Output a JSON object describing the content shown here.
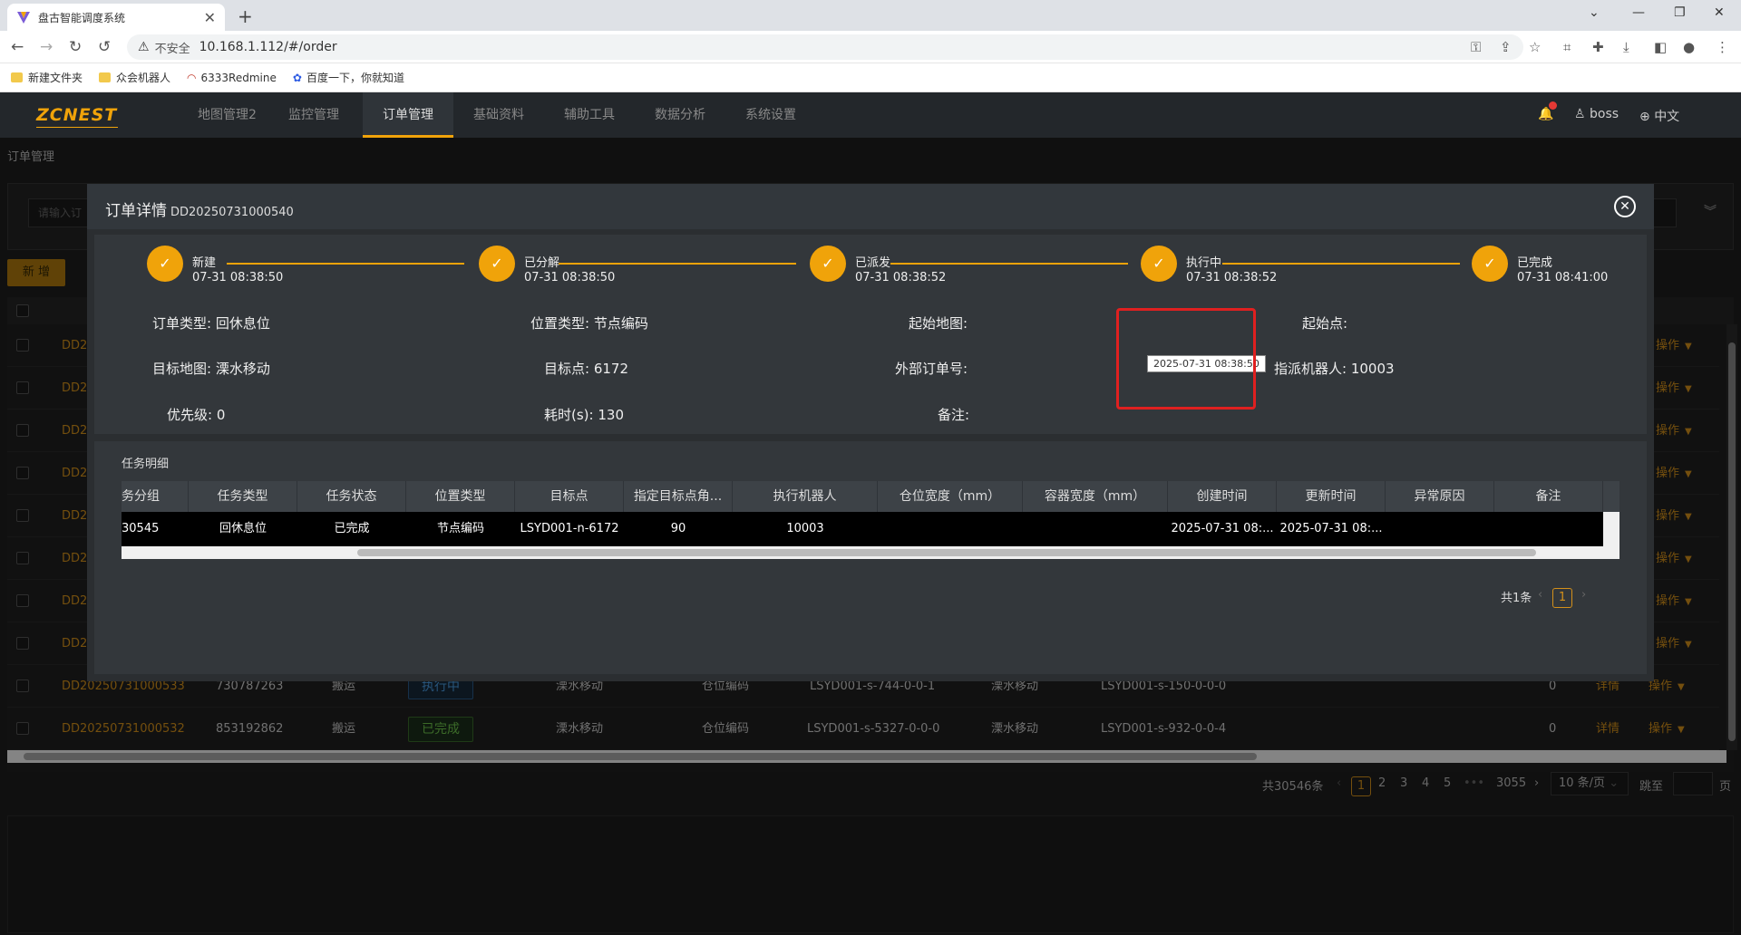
{
  "browser": {
    "tab_title": "盘古智能调度系统",
    "url": "10.168.1.112/#/order",
    "insecure_label": "不安全",
    "bookmarks": [
      {
        "label": "新建文件夹"
      },
      {
        "label": "众会机器人"
      },
      {
        "label": "6333Redmine"
      },
      {
        "label": "百度一下，你就知道"
      }
    ]
  },
  "header": {
    "logo": "ZCNEST",
    "nav": [
      "地图管理2",
      "监控管理",
      "订单管理",
      "基础资料",
      "辅助工具",
      "数据分析",
      "系统设置"
    ],
    "active_nav": "订单管理",
    "user": "boss",
    "language": "中文"
  },
  "page": {
    "breadcrumb": "订单管理",
    "filter_placeholder": "请输入订",
    "add_button": "新 增"
  },
  "order_table": {
    "rows": [
      {
        "order_no": "DD2"
      },
      {
        "order_no": "DD2"
      },
      {
        "order_no": "DD2"
      },
      {
        "order_no": "DD2"
      },
      {
        "order_no": "DD2"
      },
      {
        "order_no": "DD2"
      },
      {
        "order_no": "DD2"
      },
      {
        "order_no": "DD2"
      },
      {
        "order_no": "DD20250731000533",
        "ext_no": "730787263",
        "type": "搬运",
        "status": "执行中",
        "map": "溧水移动",
        "pos_type": "仓位编码",
        "start": "LSYD001-s-744-0-0-1",
        "target_map": "溧水移动",
        "target": "LSYD001-s-150-0-0-0",
        "count": "0"
      },
      {
        "order_no": "DD20250731000532",
        "ext_no": "853192862",
        "type": "搬运",
        "status": "已完成",
        "map": "溧水移动",
        "pos_type": "仓位编码",
        "start": "LSYD001-s-5327-0-0-0",
        "target_map": "溧水移动",
        "target": "LSYD001-s-932-0-0-4",
        "count": "0"
      }
    ],
    "detail_label": "详情",
    "op_label": "操作"
  },
  "pagination": {
    "total": "共30546条",
    "pages": [
      "1",
      "2",
      "3",
      "4",
      "5",
      "•••",
      "3055"
    ],
    "current": "1",
    "page_size": "10 条/页",
    "jump_label": "跳至",
    "page_suffix": "页"
  },
  "modal": {
    "title": "订单详情",
    "order_no": "DD20250731000540",
    "steps": [
      {
        "name": "新建",
        "time": "07-31 08:38:50"
      },
      {
        "name": "已分解",
        "time": "07-31 08:38:50"
      },
      {
        "name": "已派发",
        "time": "07-31 08:38:52"
      },
      {
        "name": "执行中",
        "time": "07-31 08:38:52"
      },
      {
        "name": "已完成",
        "time": "07-31 08:41:00"
      }
    ],
    "info": {
      "order_type": {
        "label": "订单类型:",
        "value": "回休息位"
      },
      "pos_type": {
        "label": "位置类型:",
        "value": "节点编码"
      },
      "start_map": {
        "label": "起始地图:",
        "value": ""
      },
      "start_point": {
        "label": "起始点:",
        "value": ""
      },
      "target_map": {
        "label": "目标地图:",
        "value": "溧水移动"
      },
      "target_point": {
        "label": "目标点:",
        "value": "6172"
      },
      "ext_order": {
        "label": "外部订单号:",
        "value": ""
      },
      "robot": {
        "label": "指派机器人:",
        "value": "10003"
      },
      "priority": {
        "label": "优先级:",
        "value": "0"
      },
      "duration": {
        "label": "耗时(s):",
        "value": "130"
      },
      "remark": {
        "label": "备注:",
        "value": ""
      }
    },
    "task_title": "任务明细",
    "task_columns": [
      "务分组",
      "任务类型",
      "任务状态",
      "位置类型",
      "目标点",
      "指定目标点角...",
      "执行机器人",
      "仓位宽度（mm）",
      "容器宽度（mm）",
      "创建时间",
      "更新时间",
      "异常原因",
      "备注"
    ],
    "task_row": [
      "30545",
      "回休息位",
      "已完成",
      "节点编码",
      "LSYD001-n-6172",
      "90",
      "10003",
      "",
      "",
      "2025-07-31 08:...",
      "2025-07-31 08:...",
      "",
      ""
    ],
    "tooltip": "2025-07-31 08:38:50",
    "task_total": "共1条",
    "task_page": "1"
  }
}
